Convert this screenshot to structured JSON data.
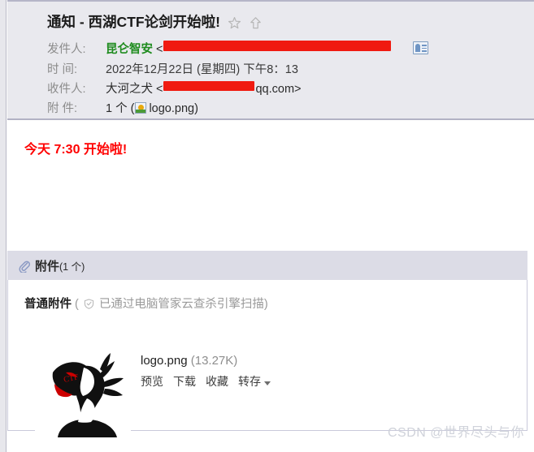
{
  "mail": {
    "subject": "通知 - 西湖CTF论剑开始啦!",
    "icons": {
      "star": "star-icon",
      "flag_up": "arrow-up-icon",
      "contact_card": "contact-card-icon",
      "file_image": "image-file-icon",
      "paperclip": "paperclip-icon",
      "shield": "shield-check-icon",
      "caret": "chevron-down-icon"
    },
    "meta": {
      "from_label": "发件人:",
      "from_name": "昆仑智安",
      "from_open_bracket": "<",
      "date_label": "时  间:",
      "date_value": "2022年12月22日 (星期四) 下午8：13",
      "to_label": "收件人:",
      "to_name": "大河之犬",
      "to_open_bracket": "<",
      "to_address_suffix": "qq.com>",
      "attach_label": "附  件:",
      "attach_count_text": "1 个 (",
      "attach_filename_text": "logo.png)"
    },
    "body_text": "今天 7:30 开始啦!"
  },
  "attachment_panel": {
    "title": "附件",
    "count": "(1 个)",
    "type_label": "普通附件",
    "scan_note_open": "(",
    "scan_note": "已通过电脑管家云查杀引擎扫描)",
    "file": {
      "name": "logo.png",
      "size": "(13.27K)",
      "actions": [
        "预览",
        "下载",
        "收藏",
        "转存"
      ]
    }
  },
  "watermark": "CSDN @世界尽头与你",
  "colors": {
    "header_bg": "#e9e9ee",
    "panel_header_bg": "#dcdce6",
    "sender_green": "#1f8c1f",
    "body_red": "#ff0000",
    "redaction_red": "#f01a10",
    "label_gray": "#8b8b8b"
  }
}
